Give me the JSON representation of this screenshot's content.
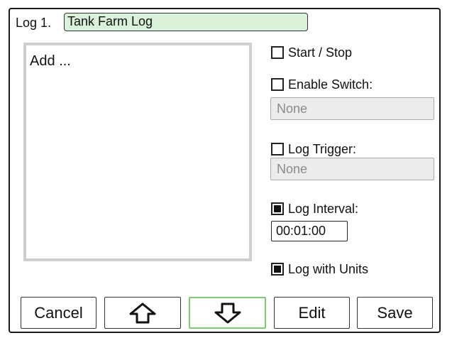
{
  "header": {
    "log_label": "Log 1.",
    "log_name": "Tank Farm Log"
  },
  "list": {
    "items": [
      "Add ..."
    ]
  },
  "options": {
    "start_stop": {
      "label": "Start / Stop",
      "checked": false
    },
    "enable_switch": {
      "label": "Enable Switch:",
      "checked": false,
      "value": "None"
    },
    "log_trigger": {
      "label": "Log Trigger:",
      "checked": false,
      "value": "None"
    },
    "log_interval": {
      "label": "Log Interval:",
      "checked": true,
      "value": "00:01:00"
    },
    "log_with_units": {
      "label": "Log with Units",
      "checked": true
    }
  },
  "buttons": {
    "cancel": "Cancel",
    "up_icon": "arrow-up-icon",
    "down_icon": "arrow-down-icon",
    "edit": "Edit",
    "save": "Save"
  },
  "colors": {
    "name_field_bg": "#d9f2d9",
    "focus_border": "#7acc6f",
    "disabled_field_bg": "#ececec"
  }
}
